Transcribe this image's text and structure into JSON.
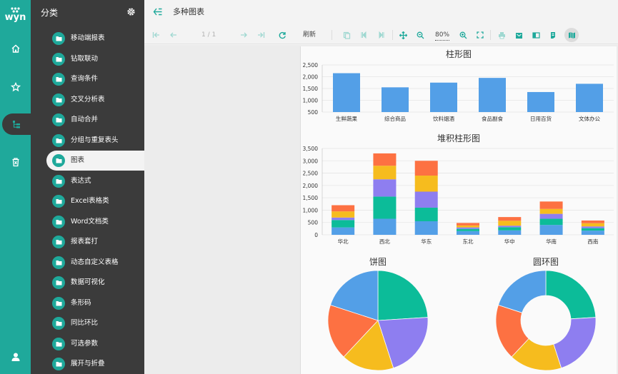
{
  "app": {
    "logo_text": "wyn"
  },
  "rail": {
    "items": [
      "home",
      "favorites",
      "categories",
      "recycle-bin",
      "user"
    ]
  },
  "panel": {
    "title": "分类",
    "items": [
      {
        "label": "移动端报表"
      },
      {
        "label": "钻取联动"
      },
      {
        "label": "查询条件"
      },
      {
        "label": "交叉分析表"
      },
      {
        "label": "自动合并"
      },
      {
        "label": "分组与重复表头"
      },
      {
        "label": "图表"
      },
      {
        "label": "表达式"
      },
      {
        "label": "Excel表格类"
      },
      {
        "label": "Word文档类"
      },
      {
        "label": "报表套打"
      },
      {
        "label": "动态自定义表格"
      },
      {
        "label": "数据可视化"
      },
      {
        "label": "条形码"
      },
      {
        "label": "同比环比"
      },
      {
        "label": "可选参数"
      },
      {
        "label": "展开与折叠"
      }
    ],
    "active_index": 6
  },
  "header": {
    "title": "多种图表"
  },
  "toolbar": {
    "page": "1 / 1",
    "refresh": "刷新",
    "zoom": "80%"
  },
  "colors": {
    "accent": "#1fa99b",
    "blue": "#539fe7",
    "teal": "#0cbc99",
    "purple": "#8e7ef0",
    "yellow": "#f6bc1e",
    "orange": "#fd7142"
  },
  "chart_data": [
    {
      "type": "bar",
      "title": "柱形图",
      "categories": [
        "生鲜蔬果",
        "综合商品",
        "饮料烟酒",
        "食品副食",
        "日用百货",
        "文体办公"
      ],
      "values": [
        2150,
        1550,
        1750,
        1950,
        1350,
        1700
      ],
      "ylim": [
        500,
        2500
      ],
      "yticks": [
        "500",
        "1,000",
        "1,500",
        "2,000",
        "2,500"
      ]
    },
    {
      "type": "bar",
      "stacked": true,
      "title": "堆积柱形图",
      "categories": [
        "华北",
        "西北",
        "华东",
        "东北",
        "华中",
        "华南",
        "西南"
      ],
      "series": [
        {
          "values": [
            300,
            650,
            550,
            150,
            180,
            400,
            170
          ]
        },
        {
          "values": [
            300,
            900,
            550,
            90,
            130,
            250,
            100
          ]
        },
        {
          "values": [
            100,
            700,
            650,
            60,
            60,
            200,
            70
          ]
        },
        {
          "values": [
            250,
            550,
            650,
            80,
            200,
            200,
            130
          ]
        },
        {
          "values": [
            250,
            500,
            600,
            100,
            150,
            300,
            110
          ]
        }
      ],
      "ylim": [
        0,
        3500
      ],
      "yticks": [
        "0",
        "500",
        "1,000",
        "1,500",
        "2,000",
        "2,500",
        "3,000",
        "3,500"
      ]
    },
    {
      "type": "pie",
      "title": "饼图",
      "values": [
        24,
        21,
        17,
        18,
        20
      ]
    },
    {
      "type": "pie",
      "donut": true,
      "title": "圆环图",
      "values": [
        24,
        21,
        17,
        18,
        20
      ]
    }
  ]
}
